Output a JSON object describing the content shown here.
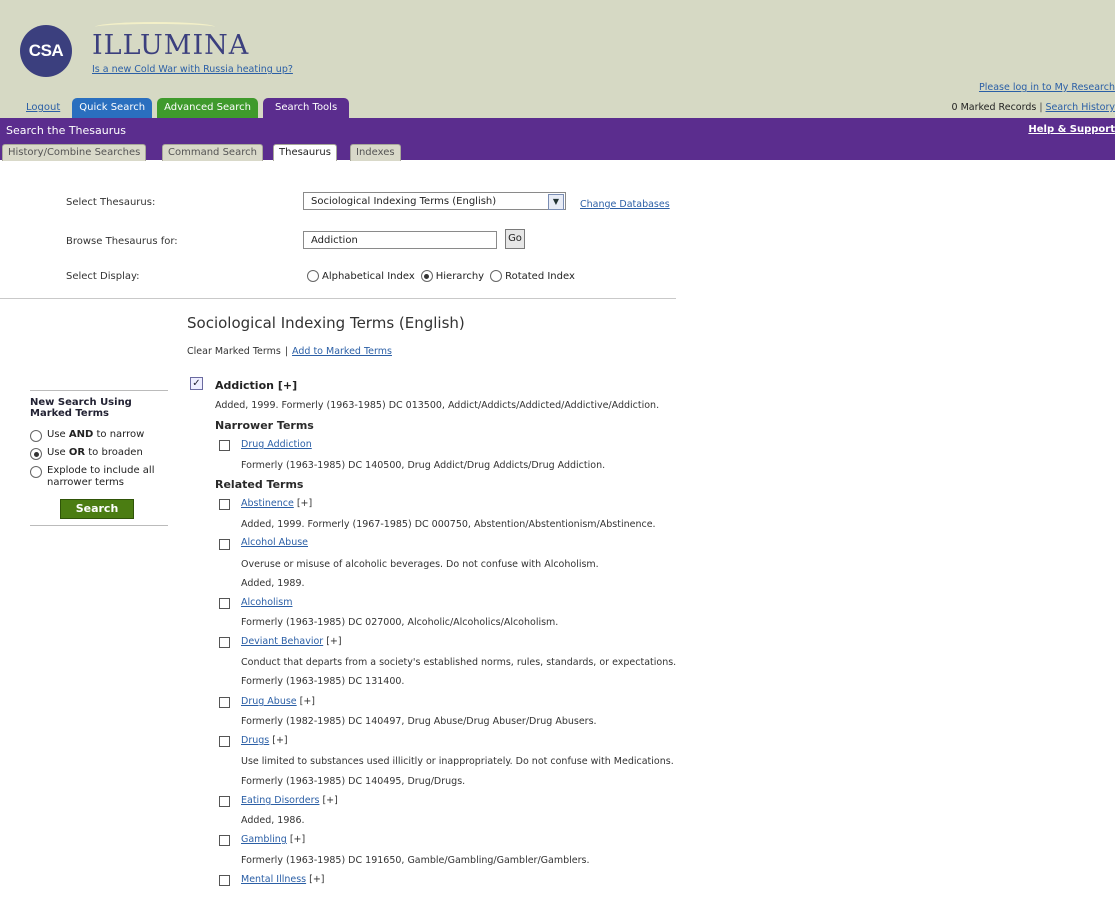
{
  "header": {
    "logo": "CSA",
    "brand": "ILLUMINA",
    "headline": "Is a new Cold War with Russia heating up?",
    "login": "Please log in to My Research",
    "marked_records": "0 Marked Records",
    "search_history": "Search History",
    "tabs": {
      "logout": "Logout",
      "quick": "Quick Search",
      "advanced": "Advanced Search",
      "tools": "Search Tools"
    }
  },
  "bar": {
    "title": "Search the Thesaurus",
    "help": "Help & Support"
  },
  "subtabs": [
    "History/Combine Searches",
    "Command Search",
    "Thesaurus",
    "Indexes"
  ],
  "form": {
    "select_label": "Select Thesaurus:",
    "select_value": "Sociological Indexing Terms (English)",
    "change_db": "Change Databases",
    "browse_label": "Browse Thesaurus for:",
    "browse_value": "Addiction",
    "go": "Go",
    "display_label": "Select Display:",
    "display_opts": [
      "Alphabetical Index",
      "Hierarchy",
      "Rotated Index"
    ],
    "display_selected": "Hierarchy"
  },
  "left": {
    "title_line1": "New Search Using",
    "title_line2": "Marked Terms",
    "opt1_pre": "Use ",
    "opt1_bold": "AND",
    "opt1_post": " to narrow",
    "opt2_pre": "Use ",
    "opt2_bold": "OR",
    "opt2_post": " to broaden",
    "opt3": "Explode to include all narrower terms",
    "selected": 2,
    "search": "Search"
  },
  "results": {
    "title": "Sociological Indexing Terms (English)",
    "clear": "Clear Marked Terms",
    "add": "Add to Marked Terms",
    "main_term": "Addiction",
    "main_plus": "[+]",
    "main_desc": "Added, 1999. Formerly (1963-1985) DC 013500, Addict/Addicts/Addicted/Addictive/Addiction.",
    "narrower_head": "Narrower Terms",
    "related_head": "Related Terms",
    "narrower": [
      {
        "name": "Drug Addiction",
        "plus": "",
        "desc": [
          "Formerly (1963-1985) DC 140500, Drug Addict/Drug Addicts/Drug Addiction."
        ]
      }
    ],
    "related": [
      {
        "name": "Abstinence",
        "plus": "[+]",
        "desc": [
          "Added, 1999. Formerly (1967-1985) DC 000750, Abstention/Abstentionism/Abstinence."
        ]
      },
      {
        "name": "Alcohol Abuse",
        "plus": "",
        "desc": [
          "Overuse or misuse of alcoholic beverages. Do not confuse with Alcoholism.",
          "Added, 1989."
        ]
      },
      {
        "name": "Alcoholism",
        "plus": "",
        "desc": [
          "Formerly (1963-1985) DC 027000, Alcoholic/Alcoholics/Alcoholism."
        ]
      },
      {
        "name": "Deviant Behavior",
        "plus": "[+]",
        "desc": [
          "Conduct that departs from a society's established norms, rules, standards, or expectations.",
          "Formerly (1963-1985) DC 131400."
        ]
      },
      {
        "name": "Drug Abuse",
        "plus": "[+]",
        "desc": [
          "Formerly (1982-1985) DC 140497, Drug Abuse/Drug Abuser/Drug Abusers."
        ]
      },
      {
        "name": "Drugs",
        "plus": "[+]",
        "desc": [
          "Use limited to substances used illicitly or inappropriately. Do not confuse with Medications.",
          "Formerly (1963-1985) DC 140495, Drug/Drugs."
        ]
      },
      {
        "name": "Eating Disorders",
        "plus": "[+]",
        "desc": [
          "Added, 1986."
        ]
      },
      {
        "name": "Gambling",
        "plus": "[+]",
        "desc": [
          "Formerly (1963-1985) DC 191650, Gamble/Gambling/Gambler/Gamblers."
        ]
      },
      {
        "name": "Mental Illness",
        "plus": "[+]",
        "desc": []
      }
    ]
  }
}
